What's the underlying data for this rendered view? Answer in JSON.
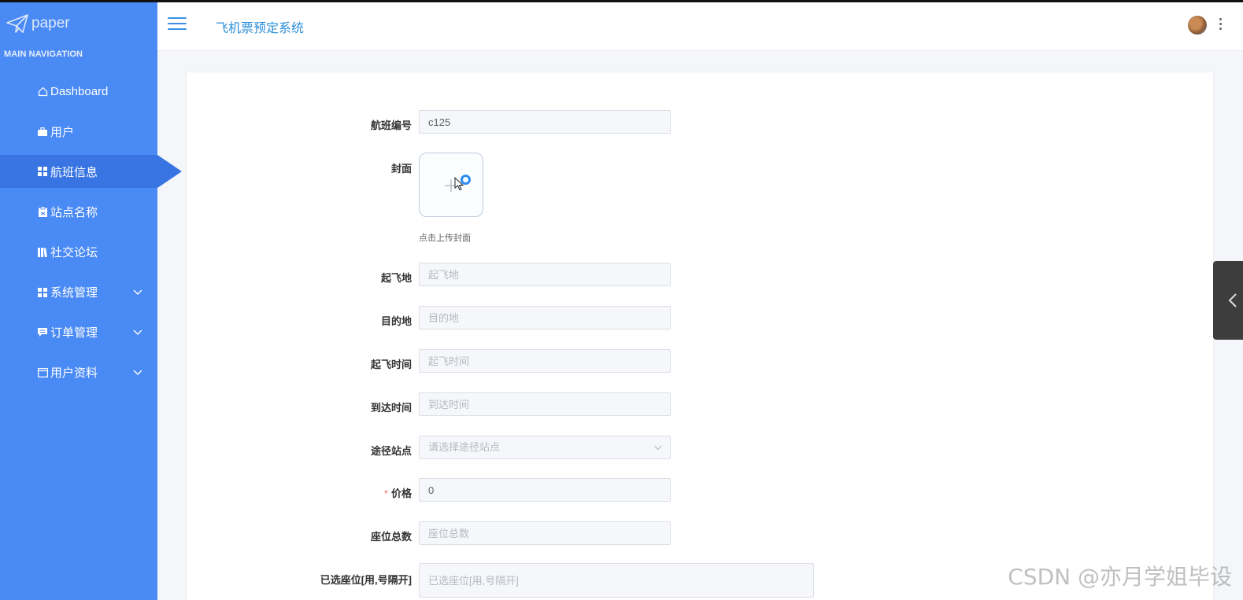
{
  "brand": {
    "name": "paper"
  },
  "sidebar": {
    "section_title": "MAIN NAVIGATION",
    "items": [
      {
        "label": "Dashboard",
        "icon": "home-icon"
      },
      {
        "label": "用户",
        "icon": "briefcase-icon"
      },
      {
        "label": "航班信息",
        "icon": "grid-icon",
        "active": true
      },
      {
        "label": "站点名称",
        "icon": "clipboard-icon"
      },
      {
        "label": "社交论坛",
        "icon": "book-icon"
      },
      {
        "label": "系统管理",
        "icon": "grid-icon",
        "expandable": true
      },
      {
        "label": "订单管理",
        "icon": "chat-icon",
        "expandable": true
      },
      {
        "label": "用户资料",
        "icon": "card-icon",
        "expandable": true
      }
    ]
  },
  "header": {
    "title": "飞机票预定系统"
  },
  "form": {
    "flight_no": {
      "label": "航班编号",
      "value": "c125"
    },
    "cover": {
      "label": "封面",
      "hint": "点击上传封面"
    },
    "departure": {
      "label": "起飞地",
      "placeholder": "起飞地"
    },
    "destination": {
      "label": "目的地",
      "placeholder": "目的地"
    },
    "depart_time": {
      "label": "起飞时间",
      "placeholder": "起飞时间"
    },
    "arrive_time": {
      "label": "到达时间",
      "placeholder": "到达时间"
    },
    "stops": {
      "label": "途径站点",
      "placeholder": "请选择途径站点"
    },
    "price": {
      "label": "价格",
      "required_mark": "*",
      "value": "0"
    },
    "total_seats": {
      "label": "座位总数",
      "placeholder": "座位总数"
    },
    "selected_seats": {
      "label": "已选座位[用,号隔开]",
      "placeholder": "已选座位[用,号隔开]"
    }
  },
  "watermark": "CSDN @亦月学姐毕设",
  "colors": {
    "sidebar": "#4a8af4",
    "sidebar_active": "#3875e3",
    "title": "#2b8fd8"
  }
}
